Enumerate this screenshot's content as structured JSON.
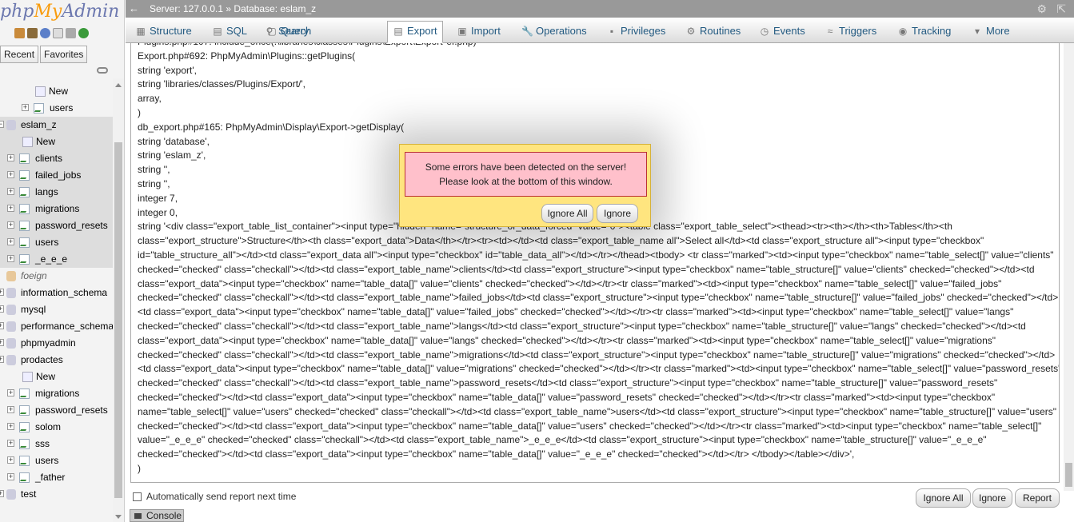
{
  "logo": {
    "php": "php",
    "my": "My",
    "admin": "Admin"
  },
  "nav": {
    "tabs": [
      "Recent",
      "Favorites"
    ],
    "tree": [
      {
        "label": "New",
        "type": "new",
        "indent": 2
      },
      {
        "label": "users",
        "type": "table",
        "indent": 2
      },
      {
        "label": "eslam_z",
        "type": "db",
        "indent": 0,
        "selected": true
      },
      {
        "label": "New",
        "type": "new",
        "indent": 1,
        "selected": true
      },
      {
        "label": "clients",
        "type": "table",
        "indent": 1,
        "selected": true
      },
      {
        "label": "failed_jobs",
        "type": "table",
        "indent": 1,
        "selected": true
      },
      {
        "label": "langs",
        "type": "table",
        "indent": 1,
        "selected": true
      },
      {
        "label": "migrations",
        "type": "table",
        "indent": 1,
        "selected": true
      },
      {
        "label": "password_resets",
        "type": "table",
        "indent": 1,
        "selected": true
      },
      {
        "label": "users",
        "type": "table",
        "indent": 1,
        "selected": true
      },
      {
        "label": "_e_e_e",
        "type": "table",
        "indent": 1,
        "selected": true
      },
      {
        "label": "foeign",
        "type": "db-italic",
        "indent": 0
      },
      {
        "label": "information_schema",
        "type": "db",
        "indent": 0
      },
      {
        "label": "mysql",
        "type": "db",
        "indent": 0
      },
      {
        "label": "performance_schema",
        "type": "db",
        "indent": 0
      },
      {
        "label": "phpmyadmin",
        "type": "db",
        "indent": 0
      },
      {
        "label": "prodactes",
        "type": "db",
        "indent": 0
      },
      {
        "label": "New",
        "type": "new",
        "indent": 1
      },
      {
        "label": "migrations",
        "type": "table",
        "indent": 1
      },
      {
        "label": "password_resets",
        "type": "table",
        "indent": 1
      },
      {
        "label": "solom",
        "type": "table",
        "indent": 1
      },
      {
        "label": "sss",
        "type": "table",
        "indent": 1
      },
      {
        "label": "users",
        "type": "table",
        "indent": 1
      },
      {
        "label": "_father",
        "type": "table",
        "indent": 1
      },
      {
        "label": "test",
        "type": "db",
        "indent": 0
      }
    ]
  },
  "topbar": {
    "back": "←",
    "breadcrumb": "Server: 127.0.0.1 » Database: eslam_z"
  },
  "tabs": [
    {
      "label": "Structure",
      "icon": "structure-icon",
      "glyph": "▦"
    },
    {
      "label": "SQL",
      "icon": "sql-icon",
      "glyph": "▤"
    },
    {
      "label": "Search",
      "icon": "search-icon",
      "glyph": "⚲"
    },
    {
      "label": "Query",
      "icon": "query-icon",
      "glyph": "▢"
    },
    {
      "label": "Export",
      "icon": "export-icon",
      "glyph": "▤",
      "active": true
    },
    {
      "label": "Import",
      "icon": "import-icon",
      "glyph": "▣"
    },
    {
      "label": "Operations",
      "icon": "wrench-icon",
      "glyph": "🔧"
    },
    {
      "label": "Privileges",
      "icon": "privileges-icon",
      "glyph": "▪"
    },
    {
      "label": "Routines",
      "icon": "routines-icon",
      "glyph": "⚙"
    },
    {
      "label": "Events",
      "icon": "clock-icon",
      "glyph": "◷"
    },
    {
      "label": "Triggers",
      "icon": "triggers-icon",
      "glyph": "≈"
    },
    {
      "label": "Tracking",
      "icon": "eye-icon",
      "glyph": "◉"
    },
    {
      "label": "More",
      "icon": "chevron-down-icon",
      "glyph": "▾"
    }
  ],
  "trace": [
    "Plugins.php#107: include_once(.\\libraries\\classes\\Plugins\\Export\\Export*ef.php)",
    "Export.php#692: PhpMyAdmin\\Plugins::getPlugins(",
    "string 'export',",
    "string 'libraries/classes/Plugins/Export/',",
    "array,",
    ")",
    "db_export.php#165: PhpMyAdmin\\Display\\Export->getDisplay(",
    "string 'database',",
    "string 'eslam_z',",
    "string '',",
    "string '',",
    "integer 7,",
    "integer 0,",
    "string '<div class=\"export_table_list_container\"><input type=\"hidden\" name=\"structure_or_data_forced\" value=\"0\"><table class=\"export_table_select\"><thead><tr><th></th><th>Tables</th><th",
    "class=\"export_structure\">Structure</th><th class=\"export_data\">Data</th></tr><tr><td></td><td class=\"export_table_name all\">Select all</td><td class=\"export_structure all\"><input type=\"checkbox\"",
    "id=\"table_structure_all\"></td><td class=\"export_data all\"><input type=\"checkbox\" id=\"table_data_all\"></td></tr></thead><tbody> <tr class=\"marked\"><td><input type=\"checkbox\" name=\"table_select[]\" value=\"clients\"",
    "checked=\"checked\" class=\"checkall\"></td><td class=\"export_table_name\">clients</td><td class=\"export_structure\"><input type=\"checkbox\" name=\"table_structure[]\" value=\"clients\" checked=\"checked\"></td><td",
    "class=\"export_data\"><input type=\"checkbox\" name=\"table_data[]\" value=\"clients\" checked=\"checked\"></td></tr><tr class=\"marked\"><td><input type=\"checkbox\" name=\"table_select[]\" value=\"failed_jobs\"",
    "checked=\"checked\" class=\"checkall\"></td><td class=\"export_table_name\">failed_jobs</td><td class=\"export_structure\"><input type=\"checkbox\" name=\"table_structure[]\" value=\"failed_jobs\" checked=\"checked\"></td>",
    "<td class=\"export_data\"><input type=\"checkbox\" name=\"table_data[]\" value=\"failed_jobs\" checked=\"checked\"></td></tr><tr class=\"marked\"><td><input type=\"checkbox\" name=\"table_select[]\" value=\"langs\"",
    "checked=\"checked\" class=\"checkall\"></td><td class=\"export_table_name\">langs</td><td class=\"export_structure\"><input type=\"checkbox\" name=\"table_structure[]\" value=\"langs\" checked=\"checked\"></td><td",
    "class=\"export_data\"><input type=\"checkbox\" name=\"table_data[]\" value=\"langs\" checked=\"checked\"></td></tr><tr class=\"marked\"><td><input type=\"checkbox\" name=\"table_select[]\" value=\"migrations\"",
    "checked=\"checked\" class=\"checkall\"></td><td class=\"export_table_name\">migrations</td><td class=\"export_structure\"><input type=\"checkbox\" name=\"table_structure[]\" value=\"migrations\" checked=\"checked\"></td>",
    "<td class=\"export_data\"><input type=\"checkbox\" name=\"table_data[]\" value=\"migrations\" checked=\"checked\"></td></tr><tr class=\"marked\"><td><input type=\"checkbox\" name=\"table_select[]\" value=\"password_resets\"",
    "checked=\"checked\" class=\"checkall\"></td><td class=\"export_table_name\">password_resets</td><td class=\"export_structure\"><input type=\"checkbox\" name=\"table_structure[]\" value=\"password_resets\"",
    "checked=\"checked\"></td><td class=\"export_data\"><input type=\"checkbox\" name=\"table_data[]\" value=\"password_resets\" checked=\"checked\"></td></tr><tr class=\"marked\"><td><input type=\"checkbox\"",
    "name=\"table_select[]\" value=\"users\" checked=\"checked\" class=\"checkall\"></td><td class=\"export_table_name\">users</td><td class=\"export_structure\"><input type=\"checkbox\" name=\"table_structure[]\" value=\"users\"",
    "checked=\"checked\"></td><td class=\"export_data\"><input type=\"checkbox\" name=\"table_data[]\" value=\"users\" checked=\"checked\"></td></tr><tr class=\"marked\"><td><input type=\"checkbox\" name=\"table_select[]\"",
    "value=\"_e_e_e\" checked=\"checked\" class=\"checkall\"></td><td class=\"export_table_name\">_e_e_e</td><td class=\"export_structure\"><input type=\"checkbox\" name=\"table_structure[]\" value=\"_e_e_e\"",
    "checked=\"checked\"></td><td class=\"export_data\"><input type=\"checkbox\" name=\"table_data[]\" value=\"_e_e_e\" checked=\"checked\"></td></tr> </tbody></table></div>',",
    ")"
  ],
  "dialog": {
    "line1": "Some errors have been detected on the server!",
    "line2": "Please look at the bottom of this window.",
    "ignore_all": "Ignore All",
    "ignore": "Ignore"
  },
  "bottom": {
    "autosend_label": "Automatically send report next time",
    "ignore_all": "Ignore All",
    "ignore": "Ignore",
    "report": "Report",
    "console": "Console"
  }
}
